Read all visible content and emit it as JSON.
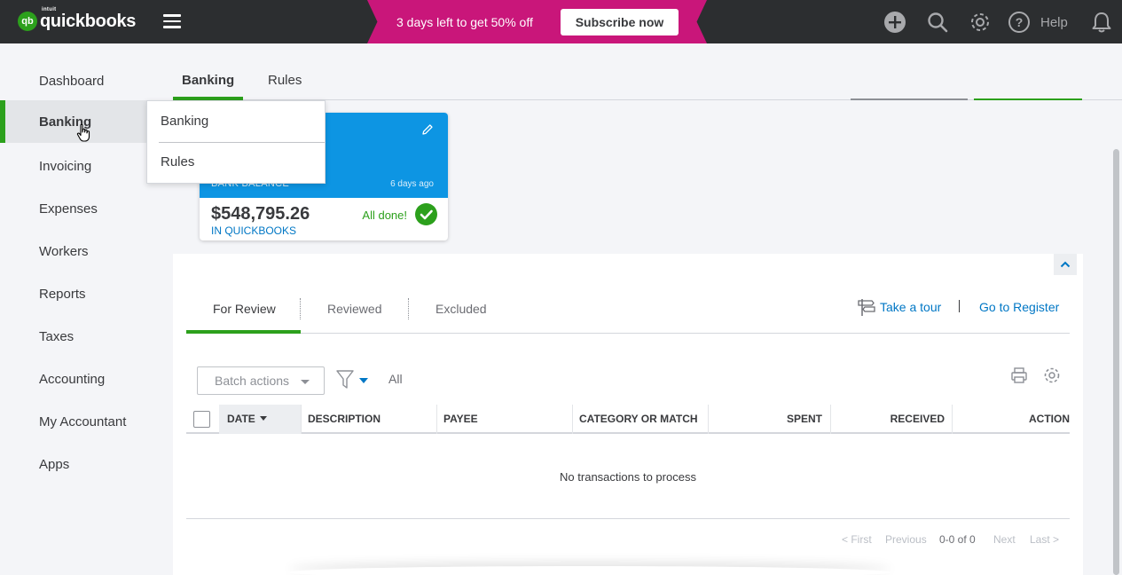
{
  "app": {
    "logo_small": "intuit",
    "logo_text": "quickbooks",
    "logo_badge": "qb"
  },
  "promo": {
    "text": "3 days left to get 50% off",
    "button_label": "Subscribe now"
  },
  "top_icons": {
    "help_label": "Help",
    "icons": [
      "plus-icon",
      "search-icon",
      "gear-icon",
      "help-icon",
      "bell-icon"
    ]
  },
  "sidebar": {
    "items": [
      {
        "label": "Dashboard"
      },
      {
        "label": "Banking"
      },
      {
        "label": "Invoicing"
      },
      {
        "label": "Expenses"
      },
      {
        "label": "Workers"
      },
      {
        "label": "Reports"
      },
      {
        "label": "Taxes"
      },
      {
        "label": "Accounting"
      },
      {
        "label": "My Accountant"
      },
      {
        "label": "Apps"
      }
    ]
  },
  "flyout": {
    "items": [
      {
        "label": "Banking"
      },
      {
        "label": "Rules"
      }
    ]
  },
  "main_tabs": [
    {
      "label": "Banking"
    },
    {
      "label": "Rules"
    }
  ],
  "account_card": {
    "bank_label": "BANK BALANCE",
    "updated": "6 days ago",
    "balance": "$548,795.26",
    "in_qb_label": "IN QUICKBOOKS",
    "status": "All done!"
  },
  "review_tabs": [
    {
      "label": "For Review"
    },
    {
      "label": "Reviewed"
    },
    {
      "label": "Excluded"
    }
  ],
  "links": {
    "take_tour": "Take a tour",
    "go_register": "Go to Register"
  },
  "toolbar": {
    "batch_actions": "Batch actions",
    "filter_value": "All"
  },
  "table": {
    "columns": [
      "DATE",
      "DESCRIPTION",
      "PAYEE",
      "CATEGORY OR MATCH",
      "SPENT",
      "RECEIVED",
      "ACTION"
    ],
    "empty_message": "No transactions to process"
  },
  "pager": {
    "first": "< First",
    "previous": "Previous",
    "count": "0-0 of 0",
    "next": "Next",
    "last": "Last >"
  },
  "colors": {
    "accent_green": "#2ca01c",
    "promo_magenta": "#c9167a",
    "card_blue": "#0d95e3",
    "link_blue": "#0077c5",
    "topbar": "#2c2e30"
  }
}
